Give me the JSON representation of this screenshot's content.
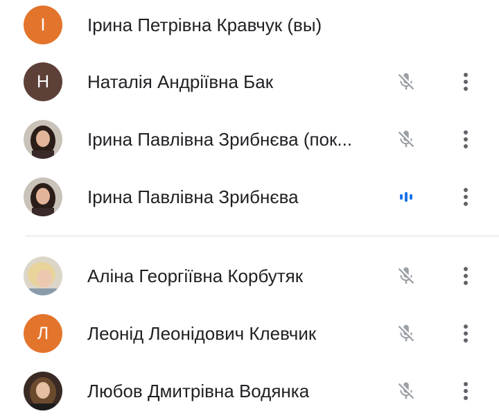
{
  "colors": {
    "orange_avatar": "#e3742b",
    "brown_avatar": "#5d4037",
    "muted_icon": "#9aa0a6",
    "speaking_icon": "#1a73e8",
    "more_icon": "#5f6368",
    "divider": "#dadce0"
  },
  "participants_top": [
    {
      "name": "Ірина Петрівна Кравчук (вы)",
      "avatar_letter": "І",
      "status": "none"
    },
    {
      "name": "Наталія Андріївна Бак",
      "avatar_letter": "Н",
      "status": "muted"
    },
    {
      "name": "Ірина Павлівна Зрибнєва (пок...",
      "avatar_letter": "",
      "status": "muted"
    },
    {
      "name": "Ірина Павлівна Зрибнєва",
      "avatar_letter": "",
      "status": "speaking"
    }
  ],
  "participants_bottom": [
    {
      "name": "Аліна Георгіївна Корбутяк",
      "avatar_letter": "",
      "status": "muted"
    },
    {
      "name": "Леонід Леонідович Клевчик",
      "avatar_letter": "Л",
      "status": "muted"
    },
    {
      "name": "Любов Дмитрівна Водянка",
      "avatar_letter": "",
      "status": "muted"
    }
  ]
}
